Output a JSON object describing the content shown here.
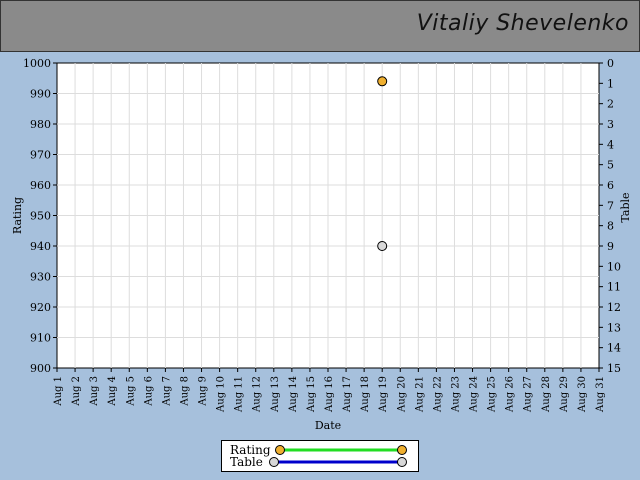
{
  "header": {
    "name": "Vitaliy Shevelenko"
  },
  "chart_data": {
    "type": "scatter",
    "xlabel": "Date",
    "ylabel": "Rating",
    "y2label": "Table",
    "categories": [
      "Aug 1",
      "Aug 2",
      "Aug 3",
      "Aug 4",
      "Aug 5",
      "Aug 6",
      "Aug 7",
      "Aug 8",
      "Aug 9",
      "Aug 10",
      "Aug 11",
      "Aug 12",
      "Aug 13",
      "Aug 14",
      "Aug 15",
      "Aug 16",
      "Aug 17",
      "Aug 18",
      "Aug 19",
      "Aug 20",
      "Aug 21",
      "Aug 22",
      "Aug 23",
      "Aug 24",
      "Aug 25",
      "Aug 26",
      "Aug 27",
      "Aug 28",
      "Aug 29",
      "Aug 30",
      "Aug 31"
    ],
    "ylim": [
      900,
      1000
    ],
    "yticks": [
      900,
      910,
      920,
      930,
      940,
      950,
      960,
      970,
      980,
      990,
      1000
    ],
    "y2lim": [
      0,
      15
    ],
    "y2ticks": [
      0,
      1,
      2,
      3,
      4,
      5,
      6,
      7,
      8,
      9,
      10,
      11,
      12,
      13,
      14,
      15
    ],
    "grid": true,
    "series": [
      {
        "name": "Rating",
        "axis": "left",
        "color": "#f0b030",
        "line_color": "#22dd22",
        "points": [
          {
            "x": "Aug 19",
            "y": 994
          }
        ]
      },
      {
        "name": "Table",
        "axis": "right",
        "color": "#d8d8d8",
        "line_color": "#0000cc",
        "points": [
          {
            "x": "Aug 19",
            "y": 9
          }
        ]
      }
    ],
    "legend": "bottom-center"
  }
}
